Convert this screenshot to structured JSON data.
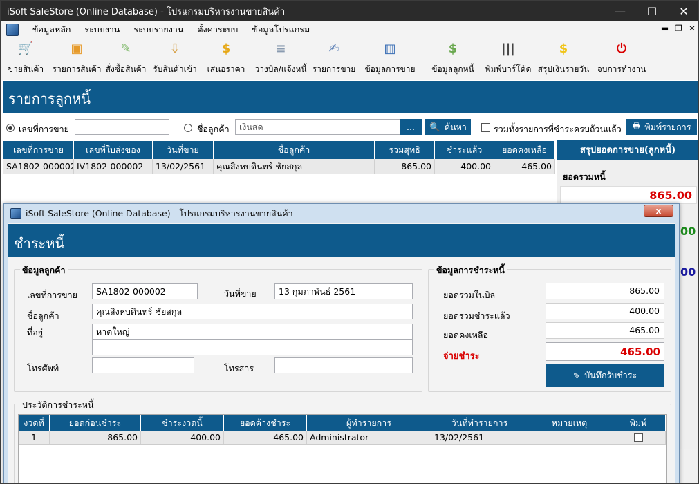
{
  "window": {
    "title": "iSoft SaleStore (Online Database) - โปรแกรมบริหารงานขายสินค้า"
  },
  "menu": [
    "ข้อมูลหลัก",
    "ระบบงาน",
    "ระบบรายงาน",
    "ตั้งค่าระบบ",
    "ข้อมูลโปรแกรม"
  ],
  "toolbar": [
    {
      "label": "ขายสินค้า",
      "icon": "cart-icon",
      "color": "#5aa23c",
      "glyph": "🛒"
    },
    {
      "label": "รายการสินค้า",
      "icon": "box-icon",
      "color": "#e69a2a",
      "glyph": "▣"
    },
    {
      "label": "สั่งซื้อสินค้า",
      "icon": "pencil-icon",
      "color": "#7fb96a",
      "glyph": "✎"
    },
    {
      "label": "รับสินค้าเข้า",
      "icon": "receive-box-icon",
      "color": "#d49a3a",
      "glyph": "⇩"
    },
    {
      "label": "เสนอราคา",
      "icon": "coin-hand-icon",
      "color": "#e6a817",
      "glyph": "$"
    },
    {
      "label": "วางบิล/แจ้งหนี้",
      "icon": "document-icon",
      "color": "#8a9bb0",
      "glyph": "≡"
    },
    {
      "label": "รายการขาย",
      "icon": "pen-paper-icon",
      "color": "#5b7fb5",
      "glyph": "✍"
    },
    {
      "label": "ข้อมูลการขาย",
      "icon": "binders-icon",
      "color": "#3b6fb5",
      "glyph": "▥"
    },
    {
      "label": "ข้อมูลลูกหนี้",
      "icon": "money-hand-icon",
      "color": "#6aa84f",
      "glyph": "$"
    },
    {
      "label": "พิมพ์บาร์โค้ด",
      "icon": "barcode-icon",
      "color": "#444444",
      "glyph": "|||"
    },
    {
      "label": "สรุปเงินรายวัน",
      "icon": "bulb-icon",
      "color": "#f0c419",
      "glyph": "$"
    },
    {
      "label": "จบการทำงาน",
      "icon": "power-icon",
      "color": "#d90000",
      "glyph": "⏻"
    }
  ],
  "page": {
    "title": "รายการลูกหนี้"
  },
  "filter": {
    "radio_sale_no": "เลขที่การขาย",
    "sale_no_value": "",
    "radio_customer": "ชื่อลูกค้า",
    "customer_value": "เงินสด",
    "browse_label": "...",
    "search_label": "ค้นหา",
    "include_paid_label": "รวมทั้งรายการที่ชำระครบถ้วนแล้ว",
    "print_label": "พิมพ์รายการ"
  },
  "grid": {
    "headers": [
      "เลขที่การขาย",
      "เลขที่ใบส่งของ",
      "วันที่ขาย",
      "ชื่อลูกค้า",
      "รวมสุทธิ",
      "ชำระแล้ว",
      "ยอดคงเหลือ"
    ],
    "rows": [
      [
        "SA1802-000002",
        "IV1802-000002",
        "13/02/2561",
        "คุณสิงหบดินทร์ ชัยสกุล",
        "865.00",
        "400.00",
        "465.00"
      ]
    ]
  },
  "summary": {
    "title": "สรุปยอดการขาย(ลูกหนี้)",
    "total_label": "ยอดรวมหนี้",
    "total_value": "865.00",
    "peek_green": "00",
    "peek_blue": "00"
  },
  "dialog": {
    "title": "iSoft SaleStore (Online Database) - โปรแกรมบริหารงานขายสินค้า",
    "close_label": "x",
    "header": "ชำระหนี้",
    "customer_group": "ข้อมูลลูกค้า",
    "sale_no_label": "เลขที่การขาย",
    "sale_no": "SA1802-000002",
    "sale_date_label": "วันที่ขาย",
    "sale_date": "13 กุมภาพันธ์ 2561",
    "customer_label": "ชื่อลูกค้า",
    "customer": "คุณสิงหบดินทร์ ชัยสกุล",
    "address_label": "ที่อยู่",
    "address1": "หาดใหญ่",
    "address2": "",
    "phone_label": "โทรศัพท์",
    "phone": "",
    "fax_label": "โทรสาร",
    "fax": "",
    "payment_group": "ข้อมูลการชำระหนี้",
    "bill_total_label": "ยอดรวมในบิล",
    "bill_total": "865.00",
    "paid_total_label": "ยอดรวมชำระแล้ว",
    "paid_total": "400.00",
    "balance_label": "ยอดคงเหลือ",
    "balance": "465.00",
    "pay_label": "จ่ายชำระ",
    "pay_value": "465.00",
    "save_label": "บันทึกรับชำระ",
    "history_group": "ประวัติการชำระหนี้",
    "history_headers": [
      "งวดที่",
      "ยอดก่อนชำระ",
      "ชำระงวดนี้",
      "ยอดค้างชำระ",
      "ผู้ทำรายการ",
      "วันที่ทำรายการ",
      "หมายเหตุ",
      "พิมพ์"
    ],
    "history_rows": [
      [
        "1",
        "865.00",
        "400.00",
        "465.00",
        "Administrator",
        "13/02/2561",
        ""
      ]
    ]
  },
  "colors": {
    "accent": "#0e5a8c",
    "danger": "#d90000",
    "green": "#1a8a1a",
    "navy": "#1a1aa0"
  }
}
